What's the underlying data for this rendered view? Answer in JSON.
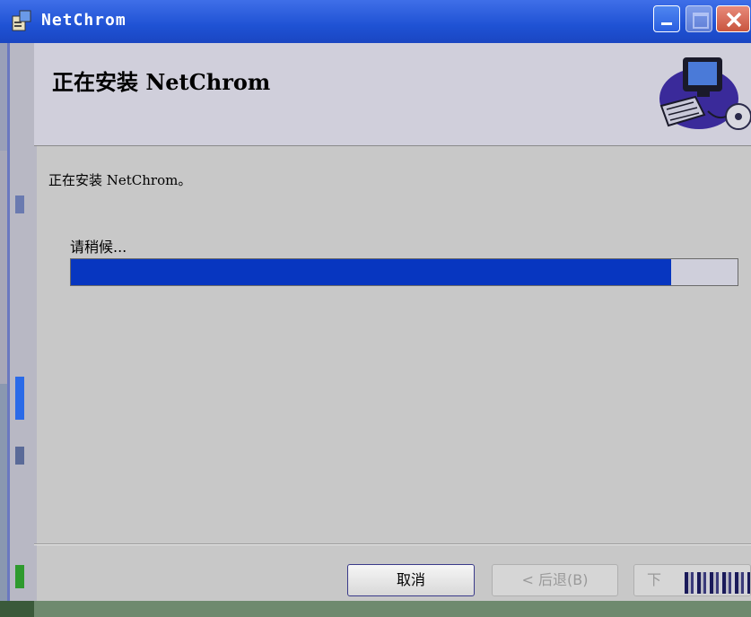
{
  "window": {
    "title": "NetChrom",
    "controls": {
      "minimize": "minimize",
      "maximize": "maximize",
      "close": "close"
    }
  },
  "header": {
    "title": "正在安装 NetChrom",
    "art_icon": "computer-disk-icon"
  },
  "content": {
    "description": "正在安装 NetChrom。",
    "status_text": "请稍候...",
    "progress_fraction": 0.9
  },
  "footer": {
    "cancel_label": "取消",
    "back_label": "< 后退(B)",
    "next_label": "下"
  },
  "colors": {
    "titlebar": "#1f52d4",
    "progress": "#0736c0",
    "dialog_bg": "#c8c8c8",
    "header_bg": "#d0cfdb"
  }
}
